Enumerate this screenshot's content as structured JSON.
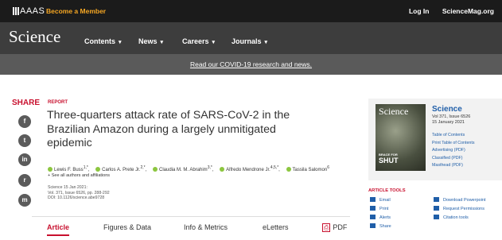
{
  "topbar": {
    "aaas": "AAAS",
    "become_member": "Become a Member",
    "login": "Log In",
    "sciencemag": "ScienceMag.org"
  },
  "nav": {
    "logo": "Science",
    "items": [
      "Contents",
      "News",
      "Careers",
      "Journals"
    ]
  },
  "banner": {
    "text": "Read our COVID-19 research and news."
  },
  "share": {
    "label": "SHARE",
    "buttons": [
      "f",
      "t",
      "in",
      "r",
      "m"
    ]
  },
  "article": {
    "type": "REPORT",
    "title": "Three-quarters attack rate of SARS-CoV-2 in the Brazilian Amazon during a largely unmitigated epidemic",
    "authors": [
      "Lewis F. Buss",
      "Carlos A. Prete Jr.",
      "Claudia M. M. Abrahim",
      "Alfredo Mendrone Jr.",
      "Tassila Salomon"
    ],
    "author_sups": [
      "1,*",
      "2,*",
      "3,*",
      "4,5,*",
      "6"
    ],
    "see_all": "+ See all authors and affiliations",
    "meta_lines": [
      "Science 15 Jan 2021:",
      "Vol. 371, Issue 6526, pp. 288-292",
      "DOI: 10.1126/science.abe9728"
    ]
  },
  "tabs": [
    "Article",
    "Figures & Data",
    "Info & Metrics",
    "eLetters",
    "PDF"
  ],
  "sidebar": {
    "cover_title": "Science",
    "cover_text": "BRACE FOR",
    "cover_headline": "SHUT",
    "brand": "Science",
    "issue": "Vol 371, Issue 6526",
    "date": "15 January 2021",
    "links": [
      "Table of Contents",
      "Print Table of Contents",
      "Advertising (PDF)",
      "Classified (PDF)",
      "Masthead (PDF)"
    ]
  },
  "tools": {
    "label": "ARTICLE TOOLS",
    "left": [
      "Email",
      "Print",
      "Alerts",
      "Share"
    ],
    "right": [
      "Download Powerpoint",
      "Request Permissions",
      "Citation tools"
    ]
  },
  "colors": {
    "accent": "#c8102e",
    "link": "#1f5ea8",
    "member": "#f5a623"
  }
}
